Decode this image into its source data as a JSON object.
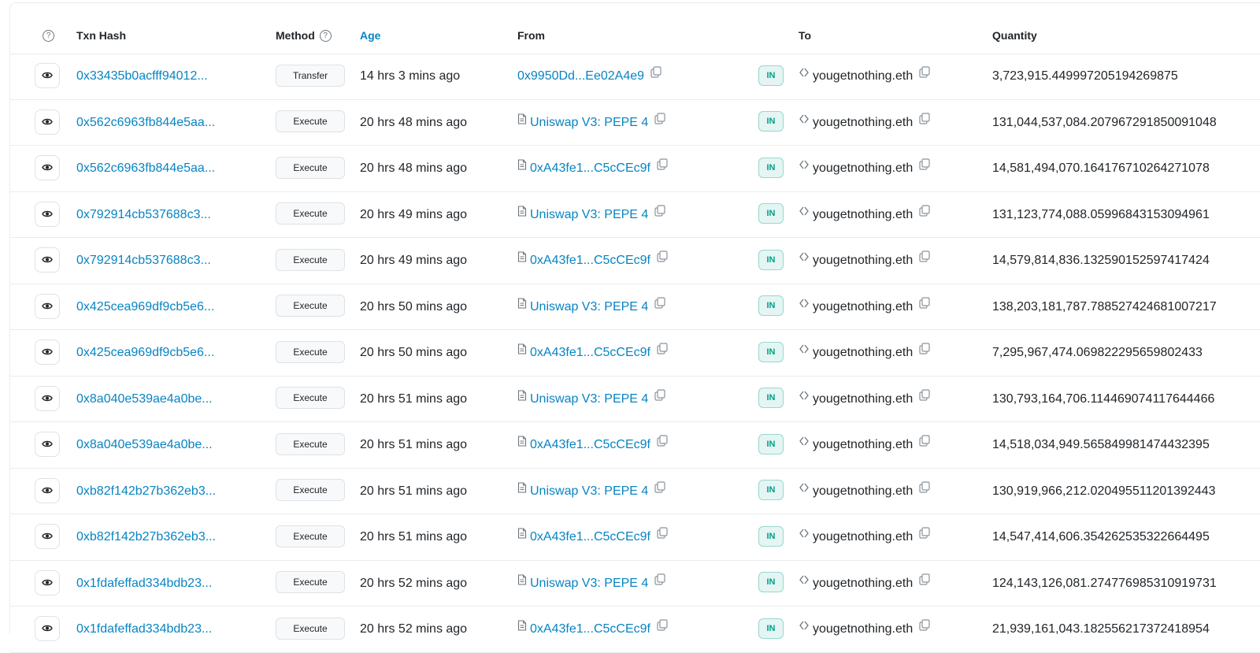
{
  "table": {
    "headers": {
      "hash": "Txn Hash",
      "method": "Method",
      "age": "Age",
      "from": "From",
      "to": "To",
      "quantity": "Quantity",
      "help_glyph": "?"
    },
    "rows": [
      {
        "hash": "0x33435b0acfff94012...",
        "method": "Transfer",
        "age": "14 hrs 3 mins ago",
        "from": "0x9950Dd...Ee02A4e9",
        "from_is_contract": false,
        "direction": "IN",
        "to": "yougetnothing.eth",
        "quantity": "3,723,915.449997205194269875"
      },
      {
        "hash": "0x562c6963fb844e5aa...",
        "method": "Execute",
        "age": "20 hrs 48 mins ago",
        "from": "Uniswap V3: PEPE 4",
        "from_is_contract": true,
        "direction": "IN",
        "to": "yougetnothing.eth",
        "quantity": "131,044,537,084.207967291850091048"
      },
      {
        "hash": "0x562c6963fb844e5aa...",
        "method": "Execute",
        "age": "20 hrs 48 mins ago",
        "from": "0xA43fe1...C5cCEc9f",
        "from_is_contract": true,
        "direction": "IN",
        "to": "yougetnothing.eth",
        "quantity": "14,581,494,070.164176710264271078"
      },
      {
        "hash": "0x792914cb537688c3...",
        "method": "Execute",
        "age": "20 hrs 49 mins ago",
        "from": "Uniswap V3: PEPE 4",
        "from_is_contract": true,
        "direction": "IN",
        "to": "yougetnothing.eth",
        "quantity": "131,123,774,088.05996843153094961"
      },
      {
        "hash": "0x792914cb537688c3...",
        "method": "Execute",
        "age": "20 hrs 49 mins ago",
        "from": "0xA43fe1...C5cCEc9f",
        "from_is_contract": true,
        "direction": "IN",
        "to": "yougetnothing.eth",
        "quantity": "14,579,814,836.132590152597417424"
      },
      {
        "hash": "0x425cea969df9cb5e6...",
        "method": "Execute",
        "age": "20 hrs 50 mins ago",
        "from": "Uniswap V3: PEPE 4",
        "from_is_contract": true,
        "direction": "IN",
        "to": "yougetnothing.eth",
        "quantity": "138,203,181,787.788527424681007217"
      },
      {
        "hash": "0x425cea969df9cb5e6...",
        "method": "Execute",
        "age": "20 hrs 50 mins ago",
        "from": "0xA43fe1...C5cCEc9f",
        "from_is_contract": true,
        "direction": "IN",
        "to": "yougetnothing.eth",
        "quantity": "7,295,967,474.069822295659802433"
      },
      {
        "hash": "0x8a040e539ae4a0be...",
        "method": "Execute",
        "age": "20 hrs 51 mins ago",
        "from": "Uniswap V3: PEPE 4",
        "from_is_contract": true,
        "direction": "IN",
        "to": "yougetnothing.eth",
        "quantity": "130,793,164,706.114469074117644466"
      },
      {
        "hash": "0x8a040e539ae4a0be...",
        "method": "Execute",
        "age": "20 hrs 51 mins ago",
        "from": "0xA43fe1...C5cCEc9f",
        "from_is_contract": true,
        "direction": "IN",
        "to": "yougetnothing.eth",
        "quantity": "14,518,034,949.565849981474432395"
      },
      {
        "hash": "0xb82f142b27b362eb3...",
        "method": "Execute",
        "age": "20 hrs 51 mins ago",
        "from": "Uniswap V3: PEPE 4",
        "from_is_contract": true,
        "direction": "IN",
        "to": "yougetnothing.eth",
        "quantity": "130,919,966,212.020495511201392443"
      },
      {
        "hash": "0xb82f142b27b362eb3...",
        "method": "Execute",
        "age": "20 hrs 51 mins ago",
        "from": "0xA43fe1...C5cCEc9f",
        "from_is_contract": true,
        "direction": "IN",
        "to": "yougetnothing.eth",
        "quantity": "14,547,414,606.354262535322664495"
      },
      {
        "hash": "0x1fdafeffad334bdb23...",
        "method": "Execute",
        "age": "20 hrs 52 mins ago",
        "from": "Uniswap V3: PEPE 4",
        "from_is_contract": true,
        "direction": "IN",
        "to": "yougetnothing.eth",
        "quantity": "124,143,126,081.274776985310919731"
      },
      {
        "hash": "0x1fdafeffad334bdb23...",
        "method": "Execute",
        "age": "20 hrs 52 mins ago",
        "from": "0xA43fe1...C5cCEc9f",
        "from_is_contract": true,
        "direction": "IN",
        "to": "yougetnothing.eth",
        "quantity": "21,939,161,043.182556217372418954"
      }
    ]
  },
  "colors": {
    "link": "#0784c3",
    "in_badge": "#00a186",
    "border": "#e9ecef"
  }
}
